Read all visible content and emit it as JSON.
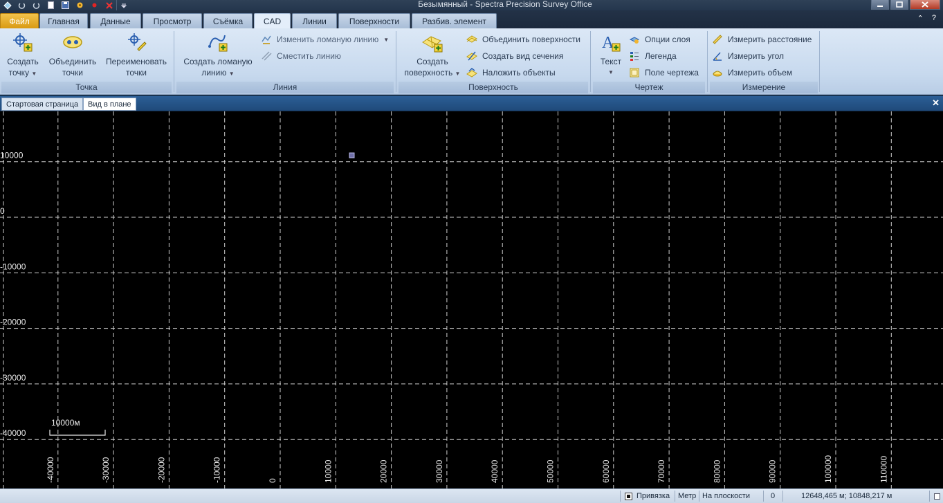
{
  "window": {
    "title": "Безымянный - Spectra Precision Survey Office",
    "controls": [
      "minimize",
      "maximize",
      "close"
    ]
  },
  "quick_access": [
    "app-icon",
    "undo-icon",
    "redo-icon",
    "new-icon",
    "save-icon",
    "settings-icon",
    "record-icon",
    "close-icon",
    "customize-icon"
  ],
  "tabs": [
    {
      "label": "Файл",
      "type": "file"
    },
    {
      "label": "Главная"
    },
    {
      "label": "Данные"
    },
    {
      "label": "Просмотр"
    },
    {
      "label": "Съёмка"
    },
    {
      "label": "CAD",
      "active": true
    },
    {
      "label": "Линии"
    },
    {
      "label": "Поверхности"
    },
    {
      "label": "Разбив. элемент"
    }
  ],
  "help_controls": {
    "collapse": "⌃",
    "help": "?"
  },
  "ribbon": {
    "point": {
      "label": "Точка",
      "create": "Создать точку",
      "create_line1": "Создать",
      "create_line2": "точку",
      "merge_line1": "Объединить",
      "merge_line2": "точки",
      "rename_line1": "Переименовать",
      "rename_line2": "точки"
    },
    "line": {
      "label": "Линия",
      "create_line1": "Создать ломаную",
      "create_line2": "линию",
      "edit": "Изменить ломаную линию",
      "offset": "Сместить линию"
    },
    "surface": {
      "label": "Поверхность",
      "create_line1": "Создать",
      "create_line2": "поверхность",
      "merge": "Объединить поверхности",
      "section": "Создать вид сечения",
      "overlay": "Наложить объекты"
    },
    "drawing": {
      "label": "Чертеж",
      "text": "Текст",
      "layer_options": "Опции слоя",
      "legend": "Легенда",
      "frame": "Поле чертежа"
    },
    "measure": {
      "label": "Измерение",
      "distance": "Измерить расстояние",
      "angle": "Измерить угол",
      "volume": "Измерить объем"
    }
  },
  "doc_tabs": [
    {
      "label": "Стартовая страница"
    },
    {
      "label": "Вид в плане",
      "active": true
    }
  ],
  "doc_close": "✕",
  "plan_view": {
    "y_axis_labels": [
      "10000",
      "0",
      "-10000",
      "-20000",
      "-30000",
      "-40000"
    ],
    "x_axis_labels": [
      "-40000",
      "-30000",
      "-20000",
      "-10000",
      "0",
      "10000",
      "20000",
      "30000",
      "40000",
      "50000",
      "60000",
      "70000",
      "80000",
      "90000",
      "100000",
      "110000"
    ],
    "scale_bar_label": "10000м",
    "background_color": "#000000",
    "grid_color": "#cfcfcf",
    "point_color": "#6f6fa8"
  },
  "status": {
    "snap": "Привязка",
    "units": "Метр",
    "projection": "На плоскости",
    "zero": "0",
    "coords": "12648,465 м; 10848,217 м"
  }
}
